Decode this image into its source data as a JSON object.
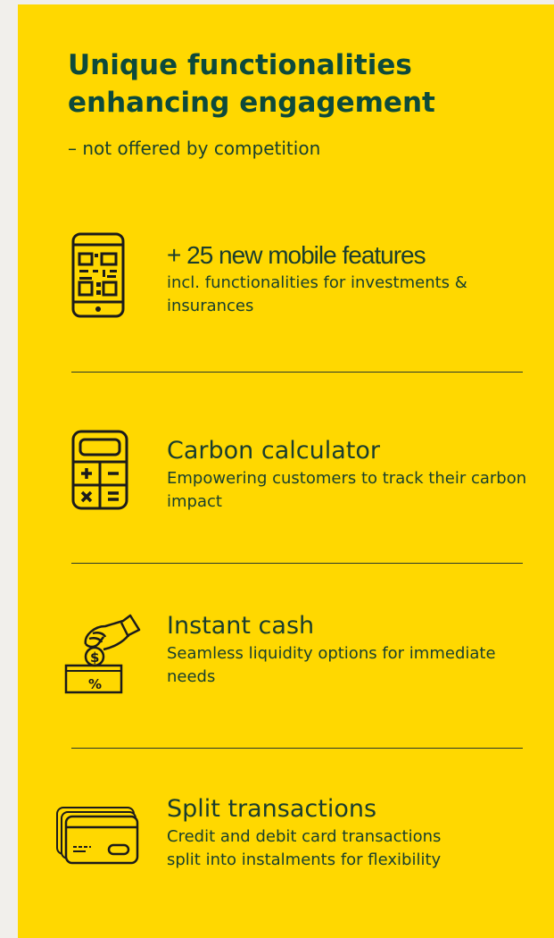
{
  "header": {
    "title": "Unique functionalities enhancing engagement",
    "subtitle": "– not offered by competition"
  },
  "features": [
    {
      "icon": "mobile-qr-icon",
      "heading": "+ 25 new mobile features",
      "description": "incl. functionalities for investments & insurances"
    },
    {
      "icon": "calculator-icon",
      "heading": "Carbon calculator",
      "description": "Empowering customers to track their carbon impact"
    },
    {
      "icon": "hand-coin-box-icon",
      "heading": "Instant cash",
      "description": "Seamless liquidity options for immediate needs",
      "icon_text_symbol": "$",
      "icon_text_percent": "%"
    },
    {
      "icon": "credit-cards-icon",
      "heading": "Split transactions",
      "description": "Credit and debit card transactions split into instalments for flexibility"
    }
  ],
  "colors": {
    "background": "#f1efeb",
    "card": "#ffd800",
    "title": "#0d4a3b",
    "text": "#173f2e",
    "icon_stroke": "#1b1b1b"
  }
}
